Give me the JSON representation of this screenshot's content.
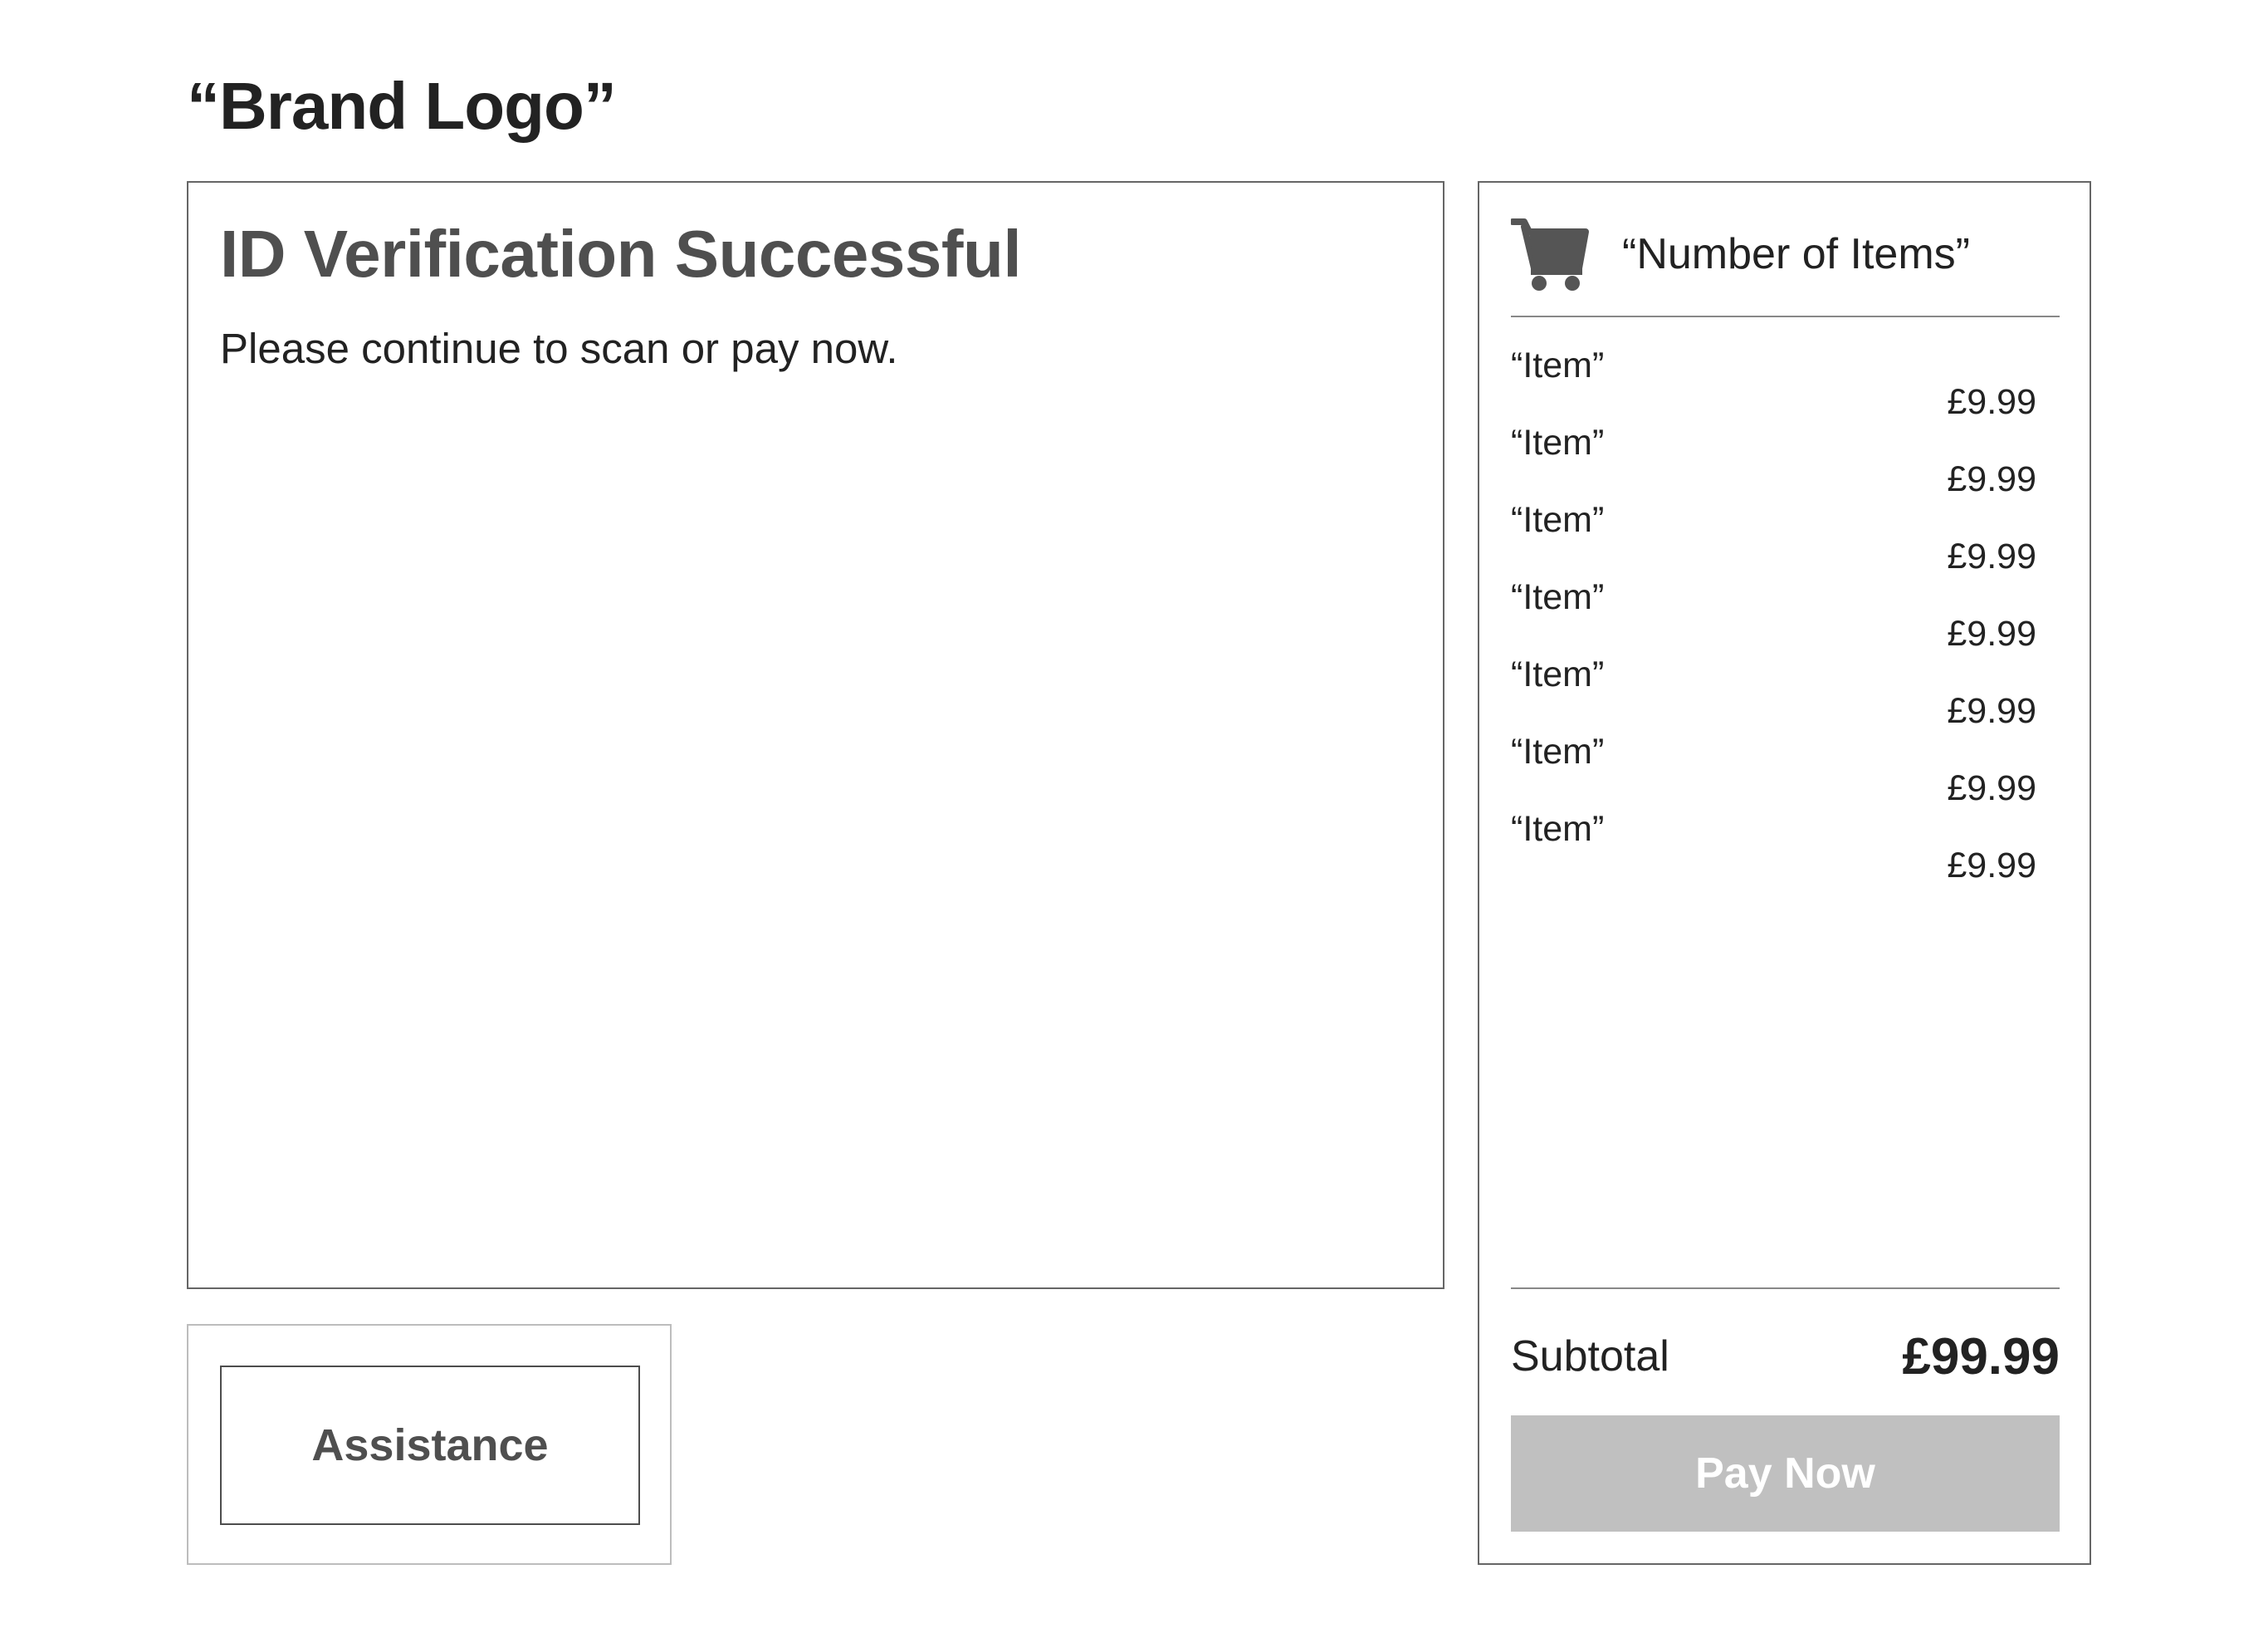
{
  "header": {
    "brand_logo": "“Brand Logo”"
  },
  "main": {
    "title": "ID Verification Successful",
    "message": "Please continue to scan or pay now."
  },
  "assistance": {
    "label": "Assistance"
  },
  "cart": {
    "icon": "shopping-cart-icon",
    "item_count_label": "“Number of Items”",
    "items": [
      {
        "name": "“Item”",
        "price": "£9.99"
      },
      {
        "name": "“Item”",
        "price": "£9.99"
      },
      {
        "name": "“Item”",
        "price": "£9.99"
      },
      {
        "name": "“Item”",
        "price": "£9.99"
      },
      {
        "name": "“Item”",
        "price": "£9.99"
      },
      {
        "name": "“Item”",
        "price": "£9.99"
      },
      {
        "name": "“Item”",
        "price": "£9.99"
      }
    ],
    "subtotal_label": "Subtotal",
    "subtotal_value": "£99.99",
    "pay_label": "Pay Now"
  },
  "colors": {
    "text_dark": "#222222",
    "heading_gray": "#4f4f4f",
    "pay_button_disabled": "#c0c0c0",
    "border": "#666666"
  }
}
